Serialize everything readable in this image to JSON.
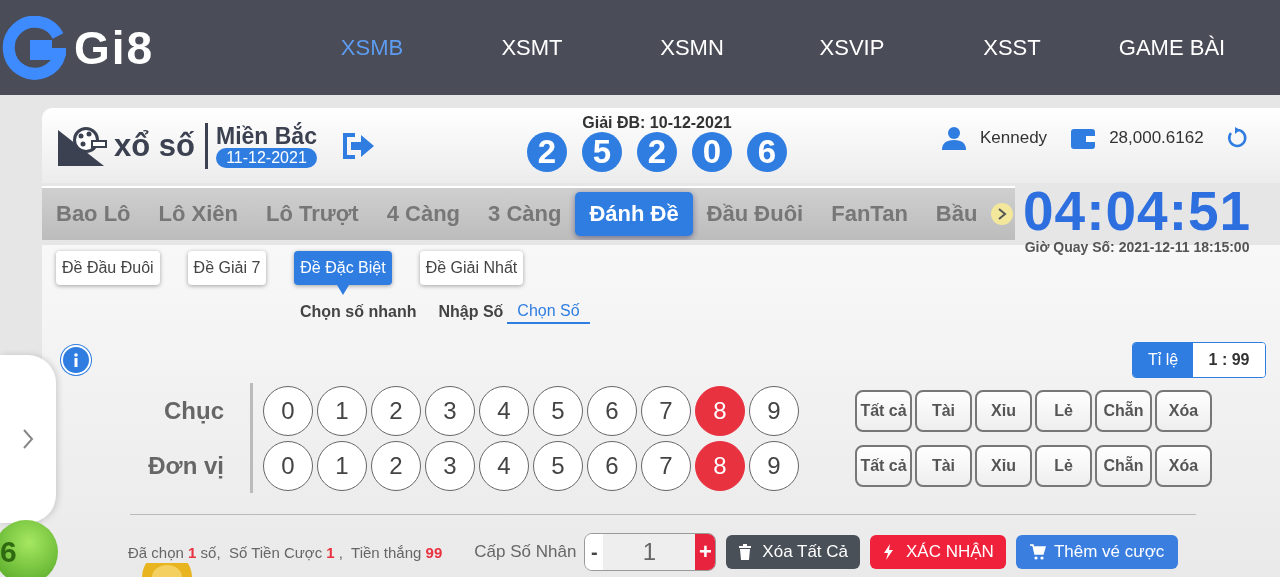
{
  "logo": {
    "text": "Gi8"
  },
  "nav": [
    {
      "label": "XSMB",
      "selected": true
    },
    {
      "label": "XSMT",
      "selected": false
    },
    {
      "label": "XSMN",
      "selected": false
    },
    {
      "label": "XSVIP",
      "selected": false
    },
    {
      "label": "XSST",
      "selected": false
    },
    {
      "label": "GAME BÀI",
      "selected": false
    }
  ],
  "lottery": {
    "title": "xổ số",
    "region": "Miền Bắc",
    "date": "11-12-2021"
  },
  "jackpot": {
    "label": "Giải ĐB: 10-12-2021",
    "digits": [
      "2",
      "5",
      "2",
      "0",
      "6"
    ]
  },
  "user": {
    "name": "Kennedy",
    "balance": "28,000.6162"
  },
  "game_tabs": [
    {
      "label": "Bao Lô",
      "selected": false
    },
    {
      "label": "Lô Xiên",
      "selected": false
    },
    {
      "label": "Lô Trượt",
      "selected": false
    },
    {
      "label": "4 Càng",
      "selected": false
    },
    {
      "label": "3 Càng",
      "selected": false
    },
    {
      "label": "Đánh Đề",
      "selected": true
    },
    {
      "label": "Đầu Đuôi",
      "selected": false
    },
    {
      "label": "FanTan",
      "selected": false
    },
    {
      "label": "Bầu",
      "selected": false
    }
  ],
  "countdown": {
    "time": "04:04:51",
    "draw_time": "Giờ Quay Số: 2021-12-11 18:15:00"
  },
  "bet_types": [
    {
      "label": "Đề Đầu Đuôi",
      "selected": false
    },
    {
      "label": "Đề Giải 7",
      "selected": false
    },
    {
      "label": "Đề Đặc Biệt",
      "selected": true
    },
    {
      "label": "Đề Giải Nhất",
      "selected": false
    }
  ],
  "input_modes": [
    {
      "label": "Chọn số nhanh",
      "selected": false
    },
    {
      "label": "Nhập Số",
      "selected": false
    },
    {
      "label": "Chọn Số",
      "selected": true
    }
  ],
  "odds": {
    "label": "Tỉ lệ",
    "value": "1 : 99"
  },
  "rows": [
    {
      "label": "Chục",
      "digits": [
        {
          "digit": "0",
          "selected": false
        },
        {
          "digit": "1",
          "selected": false
        },
        {
          "digit": "2",
          "selected": false
        },
        {
          "digit": "3",
          "selected": false
        },
        {
          "digit": "4",
          "selected": false
        },
        {
          "digit": "5",
          "selected": false
        },
        {
          "digit": "6",
          "selected": false
        },
        {
          "digit": "7",
          "selected": false
        },
        {
          "digit": "8",
          "selected": true
        },
        {
          "digit": "9",
          "selected": false
        }
      ],
      "quick": [
        "Tất cả",
        "Tài",
        "Xỉu",
        "Lẻ",
        "Chẵn",
        "Xóa"
      ]
    },
    {
      "label": "Đơn vị",
      "digits": [
        {
          "digit": "0",
          "selected": false
        },
        {
          "digit": "1",
          "selected": false
        },
        {
          "digit": "2",
          "selected": false
        },
        {
          "digit": "3",
          "selected": false
        },
        {
          "digit": "4",
          "selected": false
        },
        {
          "digit": "5",
          "selected": false
        },
        {
          "digit": "6",
          "selected": false
        },
        {
          "digit": "7",
          "selected": false
        },
        {
          "digit": "8",
          "selected": true
        },
        {
          "digit": "9",
          "selected": false
        }
      ],
      "quick": [
        "Tất cả",
        "Tài",
        "Xỉu",
        "Lẻ",
        "Chẵn",
        "Xóa"
      ]
    }
  ],
  "summary": "Đã chọn **1** số,  Số Tiền Cược **1** ,  Tiền thắng **99**",
  "multiplier": {
    "label": "Cấp Số Nhân",
    "minus": "-",
    "value": "1",
    "plus": "+"
  },
  "actions": [
    {
      "kind": "clear",
      "label": "Xóa Tất Cả"
    },
    {
      "kind": "confirm",
      "label": "XÁC NHẬN"
    },
    {
      "kind": "add",
      "label": "Thêm vé cược"
    }
  ],
  "decor_ball": {
    "label": "6"
  }
}
